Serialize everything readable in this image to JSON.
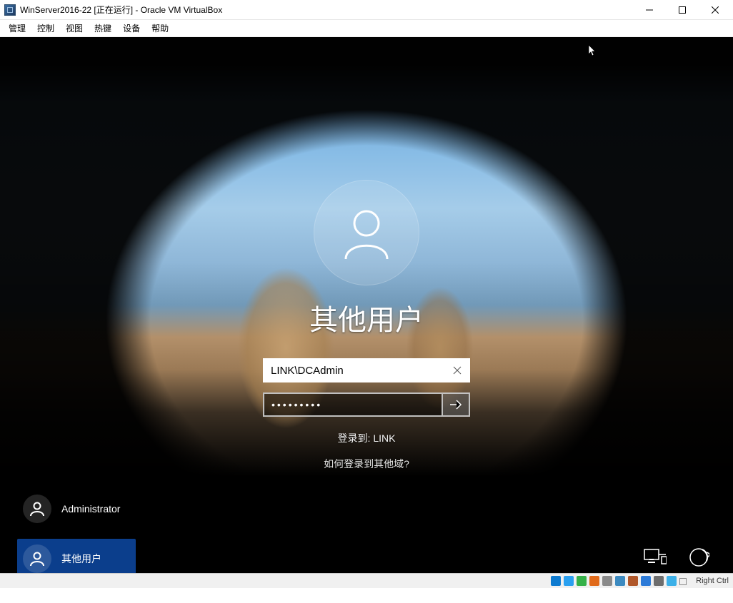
{
  "window": {
    "title": "WinServer2016-22 [正在运行] - Oracle VM VirtualBox"
  },
  "menu": {
    "items": [
      "管理",
      "控制",
      "视图",
      "热键",
      "设备",
      "帮助"
    ]
  },
  "login": {
    "displayName": "其他用户",
    "usernameValue": "LINK\\DCAdmin",
    "passwordValue": "•••••••••",
    "domainLine": "登录到: LINK",
    "helpLink": "如何登录到其他域?"
  },
  "userList": [
    {
      "label": "Administrator",
      "selected": false
    },
    {
      "label": "其他用户",
      "selected": true
    }
  ],
  "statusbar": {
    "hostKey": "Right Ctrl"
  }
}
